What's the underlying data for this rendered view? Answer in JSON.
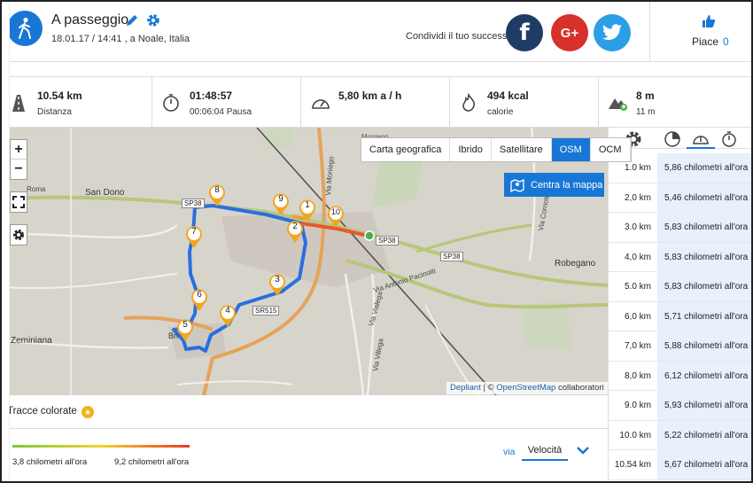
{
  "header": {
    "title": "A passeggio",
    "subtitle": "18.01.17 / 14:41 , a Noale, Italia",
    "share_text": "Condividi il tuo successo",
    "facebook_label": "f",
    "google_label": "G+",
    "like_label": "Piace",
    "like_count": "0"
  },
  "stats": [
    {
      "icon": "road-icon",
      "value": "10.54 km",
      "label": "Distanza"
    },
    {
      "icon": "stopwatch-icon",
      "value": "01:48:57",
      "label": "00:06:04 Pausa"
    },
    {
      "icon": "speedometer-icon",
      "value": "5,80 km a / h",
      "label": ""
    },
    {
      "icon": "flame-icon",
      "value": "494 kcal",
      "label": "calorie"
    },
    {
      "icon": "mountain-icon",
      "value": "8 m",
      "label": "11 m"
    }
  ],
  "map": {
    "layers": [
      "Carta geografica",
      "Ibrido",
      "Satellitare",
      "OSM",
      "OCM"
    ],
    "active_layer": "OSM",
    "center_button": "Centra la mappa",
    "zoom_in": "+",
    "zoom_out": "−",
    "attribution_link1": "Depliant",
    "attribution_sep": " | © ",
    "attribution_link2": "OpenStreetMap",
    "attribution_tail": " collaboratori",
    "place_labels": [
      "San Dono",
      "Zeminiana",
      "Robegano",
      "Moniego",
      "Via Antonio Pacinotti",
      "Via Vialega",
      "Via Villega",
      "Via Moniego"
    ],
    "road_labels": [
      "SP38",
      "SP38",
      "SP38",
      "SR515"
    ],
    "markers": [
      "1",
      "2",
      "3",
      "4",
      "5",
      "6",
      "7",
      "8",
      "9",
      "10"
    ],
    "partial_labels": [
      "Roma",
      "Mo",
      "Bri",
      "Via Corriotta"
    ]
  },
  "splits_table": {
    "header_icons": [
      "gear-icon",
      "pie-icon",
      "speedometer-icon",
      "stopwatch-icon"
    ],
    "rows": [
      {
        "km": "1.0 km",
        "speed": "5,86 chilometri all'ora"
      },
      {
        "km": "2,0 km",
        "speed": "5,46 chilometri all'ora"
      },
      {
        "km": "3.0 km",
        "speed": "5,83 chilometri all'ora"
      },
      {
        "km": "4,0 km",
        "speed": "5,83 chilometri all'ora"
      },
      {
        "km": "5.0 km",
        "speed": "5,83 chilometri all'ora"
      },
      {
        "km": "6,0 km",
        "speed": "5,71 chilometri all'ora"
      },
      {
        "km": "7,0 km",
        "speed": "5,88 chilometri all'ora"
      },
      {
        "km": "8,0 km",
        "speed": "6,12 chilometri all'ora"
      },
      {
        "km": "9.0 km",
        "speed": "5,93 chilometri all'ora"
      },
      {
        "km": "10.0 km",
        "speed": "5,22 chilometri all'ora"
      },
      {
        "km": "10.54 km",
        "speed": "5,67 chilometri all'ora"
      }
    ]
  },
  "bottom": {
    "tracce_label": "Tracce colorate",
    "star_label": "★",
    "speed_min": "3,8 chilometri all'ora",
    "speed_max": "9,2 chilometri all'ora",
    "via_label": "via",
    "selected_metric": "Velocità"
  },
  "colors": {
    "accent": "#1877d6",
    "route": "#2a6fe0",
    "marker": "#f2a51d",
    "facebook": "#1f3c67",
    "google": "#d7312b",
    "twitter": "#2a9ee6"
  }
}
